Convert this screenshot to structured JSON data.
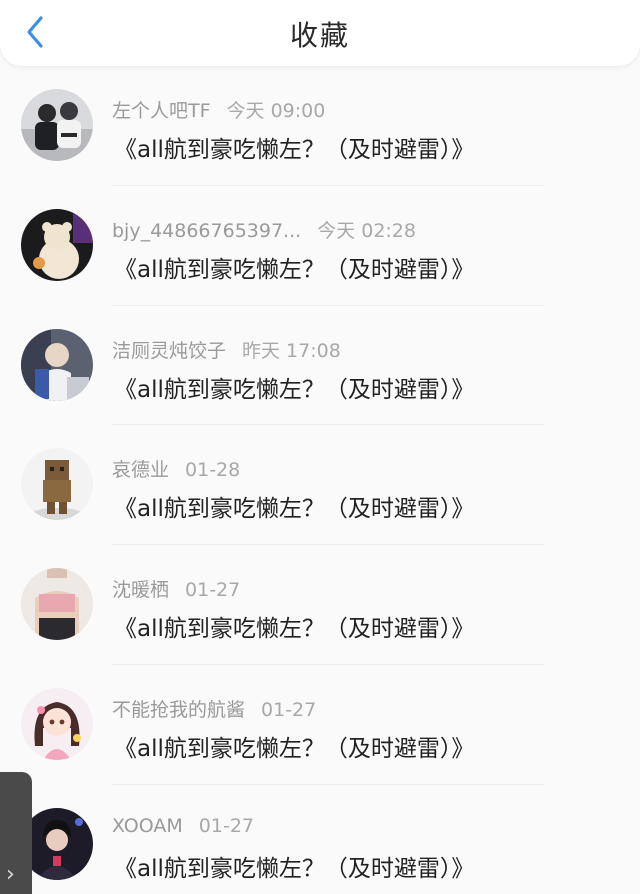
{
  "header": {
    "title": "收藏"
  },
  "items": [
    {
      "user": "左个人吧TF",
      "time": "今天 09:00",
      "message": "《all航到豪吃懒左？（及时避雷）》",
      "avatar": "avatar-two-boys-icon"
    },
    {
      "user": "bjy_44866765397...",
      "time": "今天 02:28",
      "message": "《all航到豪吃懒左？（及时避雷）》",
      "avatar": "avatar-bear-icon"
    },
    {
      "user": "洁厕灵炖饺子",
      "time": "昨天 17:08",
      "message": "《all航到豪吃懒左？（及时避雷）》",
      "avatar": "avatar-person-blue-icon"
    },
    {
      "user": "哀德业",
      "time": "01-28",
      "message": "《all航到豪吃懒左？（及时避雷）》",
      "avatar": "avatar-box-robot-icon"
    },
    {
      "user": "沈暖栖",
      "time": "01-27",
      "message": "《all航到豪吃懒左？（及时避雷）》",
      "avatar": "avatar-girl-photo-icon"
    },
    {
      "user": "不能抢我的航酱",
      "time": "01-27",
      "message": "《all航到豪吃懒左？（及时避雷）》",
      "avatar": "avatar-anime-girl-icon"
    },
    {
      "user": "XOOAM",
      "time": "01-27",
      "message": "《all航到豪吃懒左？（及时避雷）》",
      "avatar": "avatar-boy-dark-icon"
    }
  ],
  "colors": {
    "accent": "#3a8ee6",
    "text": "#222222",
    "meta": "#9a9a9a"
  }
}
